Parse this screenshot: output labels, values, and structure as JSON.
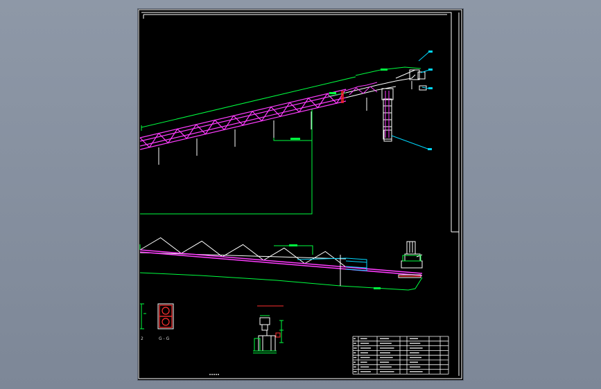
{
  "drawing": {
    "view_title": "",
    "section_label": "G - G",
    "section_marker": "2",
    "detail_title": "",
    "table_rows": 8,
    "table_cols": 7
  },
  "colors": {
    "background": "#000000",
    "frame": "#ffffff",
    "truss": "#ff3cff",
    "dimension": "#00ff40",
    "leader": "#00d8ff",
    "structure": "#ffffff",
    "highlight": "#ff2020"
  }
}
